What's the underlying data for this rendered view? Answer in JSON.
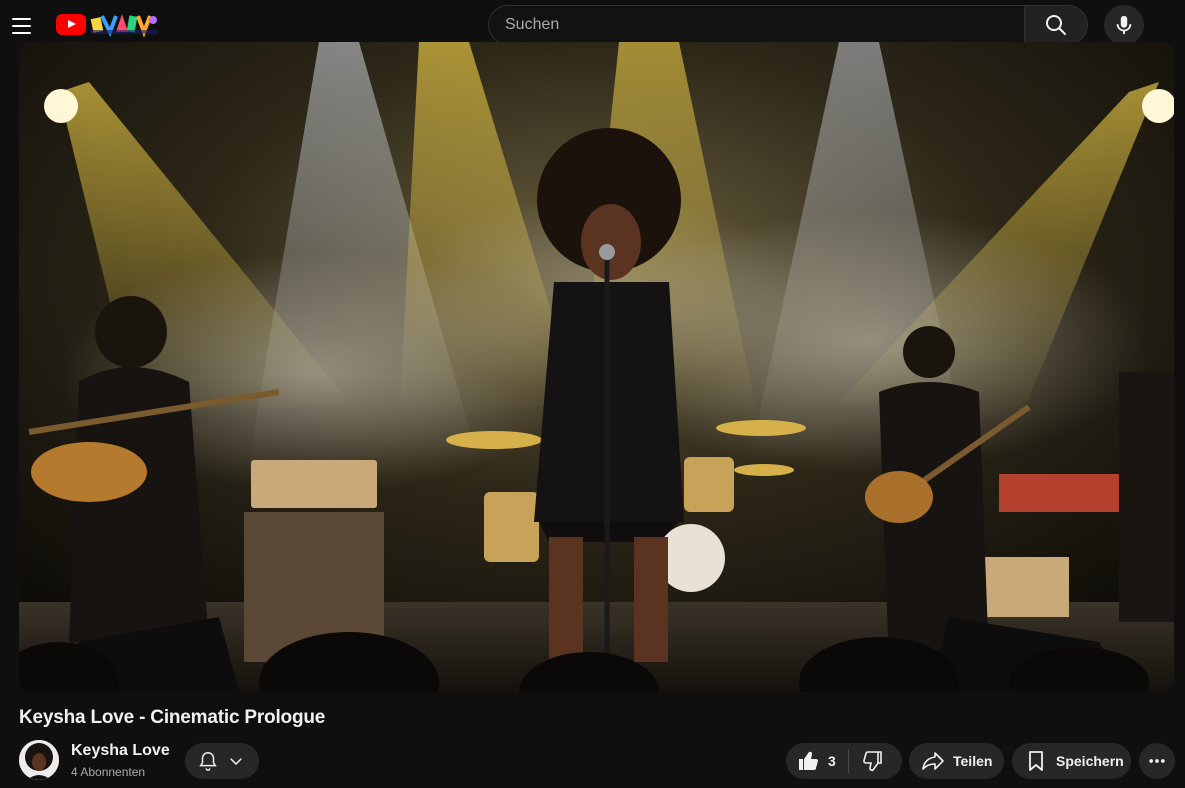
{
  "header": {
    "menu_icon": "hamburger-menu-icon",
    "logo_icon": "youtube-logo-icon",
    "search_placeholder": "Suchen",
    "search_icon": "search-icon",
    "mic_icon": "microphone-icon"
  },
  "video": {
    "title": "Keysha Love - Cinematic Prologue",
    "thumbnail": "concert-stage-singer-with-band"
  },
  "channel": {
    "name": "Keysha Love",
    "subscribers": "4 Abonnenten",
    "bell_icon": "bell-icon",
    "chevron_icon": "chevron-down-icon"
  },
  "actions": {
    "like_count": "3",
    "share_label": "Teilen",
    "save_label": "Speichern",
    "more_icon": "more-horizontal-icon"
  },
  "colors": {
    "background": "#0f0f0f",
    "button_bg": "#272727",
    "brand_red": "#ff0000",
    "text_primary": "#f1f1f1",
    "text_secondary": "#aaaaaa"
  }
}
